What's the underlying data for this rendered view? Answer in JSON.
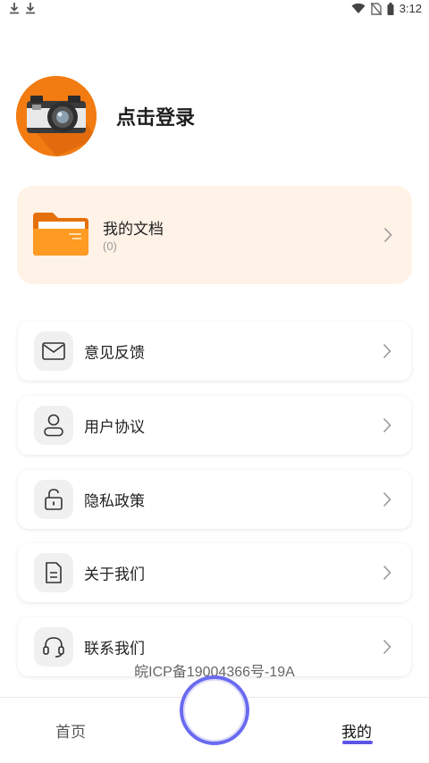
{
  "status_bar": {
    "time": "3:12",
    "left_icons": [
      "download-icon",
      "download-icon"
    ],
    "right_icons": [
      "wifi-icon",
      "no-sim-icon",
      "battery-icon"
    ]
  },
  "profile": {
    "login_label": "点击登录",
    "avatar_icon": "camera-avatar-icon"
  },
  "docs": {
    "title": "我的文档",
    "count": "(0)",
    "accent": "#fff2e6"
  },
  "menu": {
    "items": [
      {
        "label": "意见反馈",
        "icon": "mail-icon"
      },
      {
        "label": "用户协议",
        "icon": "user-icon"
      },
      {
        "label": "隐私政策",
        "icon": "unlock-icon"
      },
      {
        "label": "关于我们",
        "icon": "document-icon"
      },
      {
        "label": "联系我们",
        "icon": "headset-icon"
      }
    ]
  },
  "footer": {
    "icp": "皖ICP备19004366号-19A"
  },
  "tabbar": {
    "home_label": "首页",
    "mine_label": "我的",
    "accent": "#5b55e6"
  }
}
